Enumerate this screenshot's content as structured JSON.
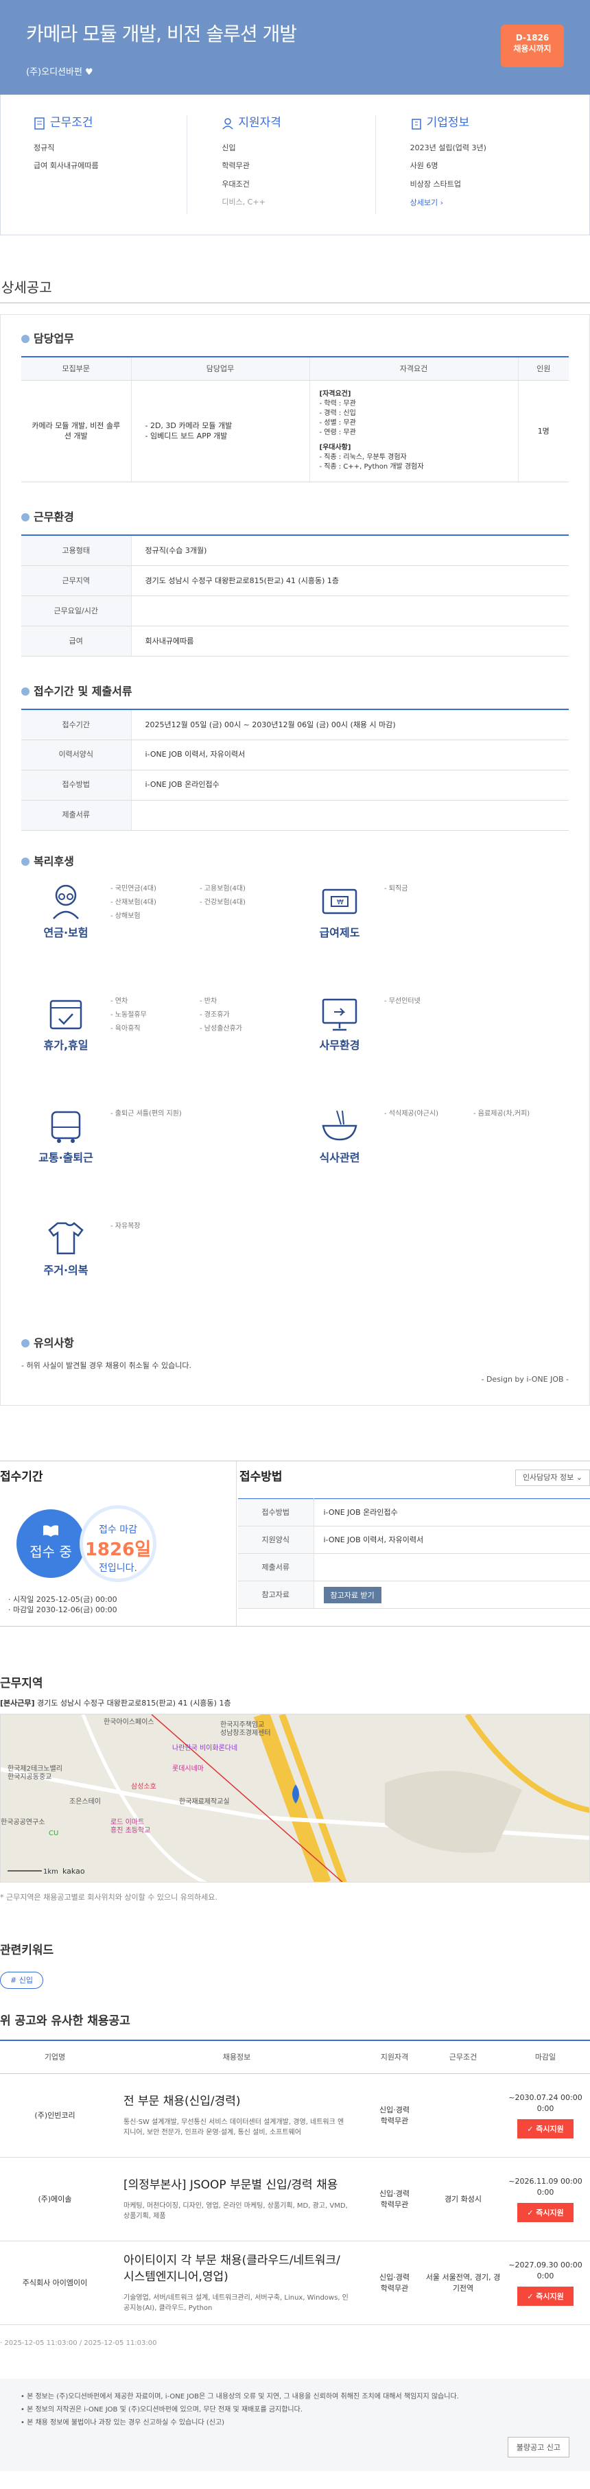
{
  "hero": {
    "title": "카메라 모듈 개발, 비전 솔루션 개발",
    "company": "(주)오디션바펀 ♥",
    "dday": "D-1826",
    "dday_sub": "채용시까지"
  },
  "summary": [
    {
      "title": "근무조건",
      "items": [
        "정규직",
        "급여 회사내규에따름"
      ],
      "gray": []
    },
    {
      "title": "지원자격",
      "items": [
        "신입",
        "학력무관",
        "우대조건"
      ],
      "gray": [
        "디비스, C++"
      ]
    },
    {
      "title": "기업정보",
      "items": [
        "2023년 설립(업력 3년)",
        "사원 6명",
        "비상장 스타트업"
      ],
      "gray": [],
      "link": "상세보기 ›"
    }
  ],
  "section_title": "상세공고",
  "duty": {
    "title": "담당업무",
    "headers": [
      "모집부문",
      "담당업무",
      "자격요건",
      "인원"
    ],
    "row": {
      "part": "카메라 모듈 개발, 비전 솔루션 개발",
      "duty": "- 2D, 3D 카메라 모듈 개발\n- 임베디드 보드 APP 개발",
      "req1_title": "[자격요건]",
      "req1": "- 학력 : 무관\n- 경력 : 신입\n- 성별 : 무관\n- 연령 : 무관",
      "req2_title": "[우대사항]",
      "req2": "- 직종 : 리눅스, 우분투 경험자\n- 직종 : C++, Python 개발 경험자",
      "count": "1명"
    }
  },
  "env": {
    "title": "근무환경",
    "rows": [
      [
        "고용형태",
        "정규직(수습 3개월)"
      ],
      [
        "근무지역",
        "경기도 성남시 수정구 대왕판교로815(판교) 41 (시흥동) 1층"
      ],
      [
        "근무요일/시간",
        ""
      ],
      [
        "급여",
        "회사내규에따름"
      ]
    ]
  },
  "apply": {
    "title": "접수기간 및 제출서류",
    "rows": [
      [
        "접수기간",
        "2025년12월 05일 (금) 00시 ~ 2030년12월 06일 (금) 00시 (채용 시 마감)"
      ],
      [
        "이력서양식",
        "i-ONE JOB 이력서, 자유이력서"
      ],
      [
        "접수방법",
        "i-ONE JOB 온라인접수"
      ],
      [
        "제출서류",
        ""
      ]
    ]
  },
  "benefits": {
    "title": "복리후생",
    "groups": [
      {
        "name": "연금·보험",
        "items": [
          "국민연금(4대)",
          "고용보험(4대)",
          "산재보험(4대)",
          "건강보험(4대)",
          "상해보험"
        ]
      },
      {
        "name": "급여제도",
        "items": [
          "퇴직금"
        ]
      },
      {
        "name": "휴가,휴일",
        "items": [
          "연차",
          "반차",
          "노동절휴무",
          "경조휴가",
          "육아휴직",
          "남성출산휴가"
        ]
      },
      {
        "name": "사무환경",
        "items": [
          "무선인터넷"
        ]
      },
      {
        "name": "교통·출퇴근",
        "items": [
          "출퇴근 셔틀(편의 지원)"
        ]
      },
      {
        "name": "식사관련",
        "items": [
          "석식제공(야근시)",
          "음료제공(차,커피)"
        ]
      },
      {
        "name": "주거·의복",
        "items": [
          "자유복장"
        ]
      }
    ]
  },
  "notice": {
    "title": "유의사항",
    "text": "- 허위 사실이 발견될 경우 채용이 취소될 수 있습니다.",
    "design": "- Design by i-ONE JOB -"
  },
  "period": {
    "title": "접수기간",
    "status": "접수 중",
    "deadline_label": "접수 마감",
    "deadline_days": "1826일",
    "deadline_sub": "전입니다.",
    "start": "· 시작일 2025-12-05(금) 00:00",
    "end": "· 마감일 2030-12-06(금) 00:00"
  },
  "method": {
    "title": "접수방법",
    "info_select": "인사담당자 정보 ⌄",
    "rows": [
      [
        "접수방법",
        "i-ONE JOB 온라인접수"
      ],
      [
        "지원양식",
        "i-ONE JOB 이력서, 자유이력서"
      ],
      [
        "제출서류",
        ""
      ],
      [
        "참고자료",
        ""
      ]
    ],
    "ref_btn": "참고자료 받기"
  },
  "location": {
    "title": "근무지역",
    "addr_label": "[본사근무]",
    "addr": "경기도 성남시 수정구 대왕판교로815(판교) 41 (시흥동) 1층",
    "note": "* 근무지역은 채용공고별로 회사위치와 상이할 수 있으니 유의하세요.",
    "map_labels": [
      "한국아이스페이스",
      "한국지주책임교",
      "성남창조경제센터",
      "나란한국 비이화론다네",
      "롯데시네마",
      "삼성소호",
      "한국재료제작교실",
      "한국제2테크노밸리",
      "한국지공동중교",
      "조은스테이",
      "한국공공연구소",
      "CU",
      "로드 이마트",
      "흥진 초등학교",
      "kakao",
      "1km"
    ]
  },
  "keyword": {
    "title": "관련키워드",
    "tag": "# 신입"
  },
  "related": {
    "title": "위 공고와 유사한 채용공고",
    "headers": [
      "기업명",
      "채용정보",
      "지원자격",
      "근무조건",
      "마감일"
    ],
    "rows": [
      {
        "company": "(주)인빈코리",
        "title": "전 부문 채용(신입/경력)",
        "desc": "통신·SW 설계개발, 무선통신 서비스 데이터센터 설계개발, 경영, 네트워크 엔지니어, 보안 전문가, 인프라 운영·설계, 통신 설비, 소프트웨어",
        "qual": "신입·경력\n학력무관",
        "cond": "",
        "deadline": "~2030.07.24 00:00 0:00",
        "btn": "✓ 즉시지원"
      },
      {
        "company": "(주)에이솔",
        "title": "[의정부본사] JSOOP 부문별 신입/경력 채용",
        "desc": "마케팅, 머천다이징, 디자인, 영업, 온라인 마케팅, 상품기획, MD, 광고, VMD, 상품기획, 제품",
        "qual": "신입·경력\n학력무관",
        "cond": "경기 화성시",
        "deadline": "~2026.11.09 00:00 0:00",
        "btn": "✓ 즉시지원"
      },
      {
        "company": "주식회사 아이엠이이",
        "title": "아이티이지 각 부문 채용(클라우드/네트워크/시스템엔지니어,영업)",
        "desc": "기술영업, 서버/네트워크 설계, 네트워크관리, 서버구축, Linux, Windows, 인공지능(AI), 클라우드, Python",
        "qual": "신입·경력\n학력무관",
        "cond": "서울 서울전역, 경기, 경기전역",
        "deadline": "~2027.09.30 00:00 0:00",
        "btn": "✓ 즉시지원"
      }
    ]
  },
  "timestamp": "· 2025-12-05 11:03:00 / 2025-12-05 11:03:00",
  "footer": {
    "items": [
      "본 정보는 (주)오디션바펀에서 제공한 자료이며, i-ONE JOB은 그 내용상의 오류 및 지연, 그 내용을 신뢰하여 취해진 조치에 대해서 책임지지 않습니다.",
      "본 정보의 저작권은 i-ONE JOB 및 (주)오디션바펀에 있으며, 무단 전재 및 재배포를 금지합니다.",
      "본 채용 정보에 불법이나 과장 있는 경우 신고하실 수 있습니다 (신고)"
    ],
    "report": "불량공고 신고"
  }
}
